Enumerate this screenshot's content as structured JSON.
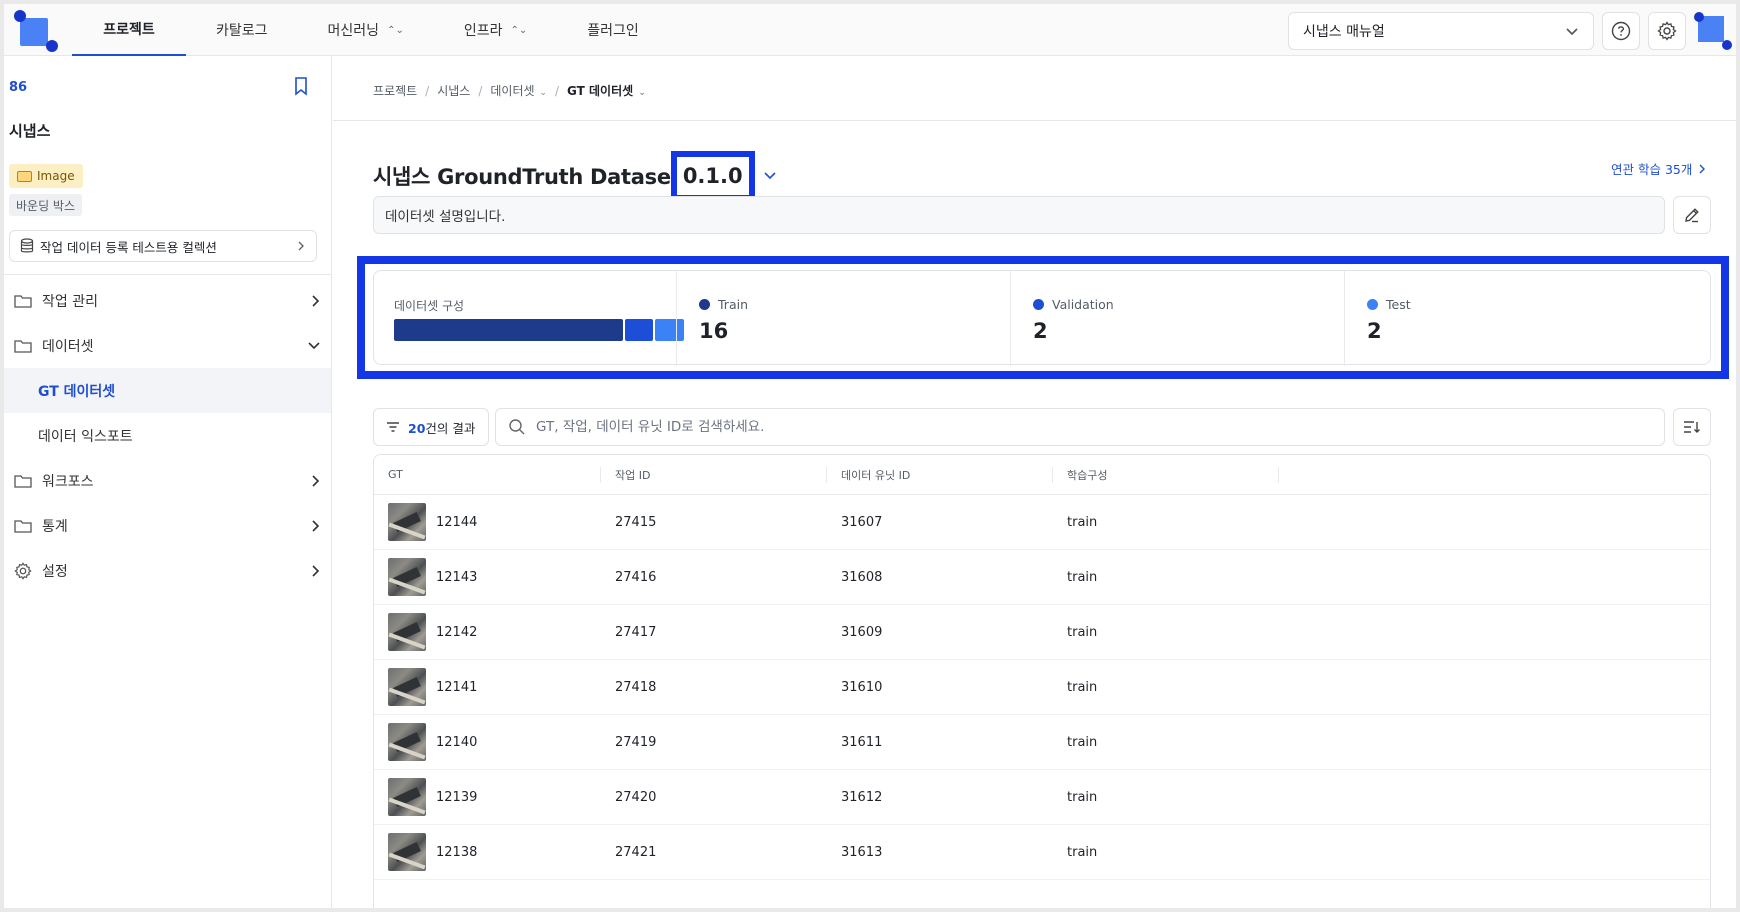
{
  "topbar": {
    "tabs": [
      {
        "label": "프로젝트",
        "active": true,
        "has_caret": false
      },
      {
        "label": "카탈로그",
        "active": false,
        "has_caret": false
      },
      {
        "label": "머신러닝",
        "active": false,
        "has_caret": true
      },
      {
        "label": "인프라",
        "active": false,
        "has_caret": true
      },
      {
        "label": "플러그인",
        "active": false,
        "has_caret": false
      }
    ],
    "manual_select": "시냅스 매뉴얼",
    "help_icon": "question-circle-icon",
    "settings_icon": "gear-icon"
  },
  "sidebar": {
    "project_id": "86",
    "project_name": "시냅스",
    "badge_type": "Image",
    "badge_annotation": "바운딩 박스",
    "collection": "작업 데이터 등록 테스트용 컬렉션",
    "menu": {
      "work": "작업 관리",
      "dataset": "데이터셋",
      "gt_dataset": "GT 데이터셋",
      "data_export": "데이터 익스포트",
      "workforce": "워크포스",
      "stats": "통계",
      "settings": "설정"
    }
  },
  "breadcrumb": {
    "project": "프로젝트",
    "name": "시냅스",
    "dataset": "데이터셋",
    "current": "GT 데이터셋"
  },
  "dataset": {
    "title": "시냅스 GroundTruth Datase",
    "version": "0.1.0",
    "related_link": "연관 학습 35개",
    "description": "데이터셋 설명입니다."
  },
  "summary": {
    "composition_label": "데이터셋 구성",
    "splits": [
      {
        "name": "Train",
        "count": "16",
        "value": 16,
        "color": "#1e3a8a"
      },
      {
        "name": "Validation",
        "count": "2",
        "value": 2,
        "color": "#1d4ed8"
      },
      {
        "name": "Test",
        "count": "2",
        "value": 2,
        "color": "#3b82f6"
      }
    ]
  },
  "toolbar": {
    "result_count": "20",
    "result_suffix": "건의 결과",
    "search_placeholder": "GT, 작업, 데이터 유닛 ID로 검색하세요."
  },
  "table": {
    "headers": [
      "GT",
      "작업 ID",
      "데이터 유닛 ID",
      "학습구성"
    ],
    "rows": [
      {
        "gt": "12144",
        "job": "27415",
        "unit": "31607",
        "split": "train"
      },
      {
        "gt": "12143",
        "job": "27416",
        "unit": "31608",
        "split": "train"
      },
      {
        "gt": "12142",
        "job": "27417",
        "unit": "31609",
        "split": "train"
      },
      {
        "gt": "12141",
        "job": "27418",
        "unit": "31610",
        "split": "train"
      },
      {
        "gt": "12140",
        "job": "27419",
        "unit": "31611",
        "split": "train"
      },
      {
        "gt": "12139",
        "job": "27420",
        "unit": "31612",
        "split": "train"
      },
      {
        "gt": "12138",
        "job": "27421",
        "unit": "31613",
        "split": "train"
      }
    ]
  }
}
